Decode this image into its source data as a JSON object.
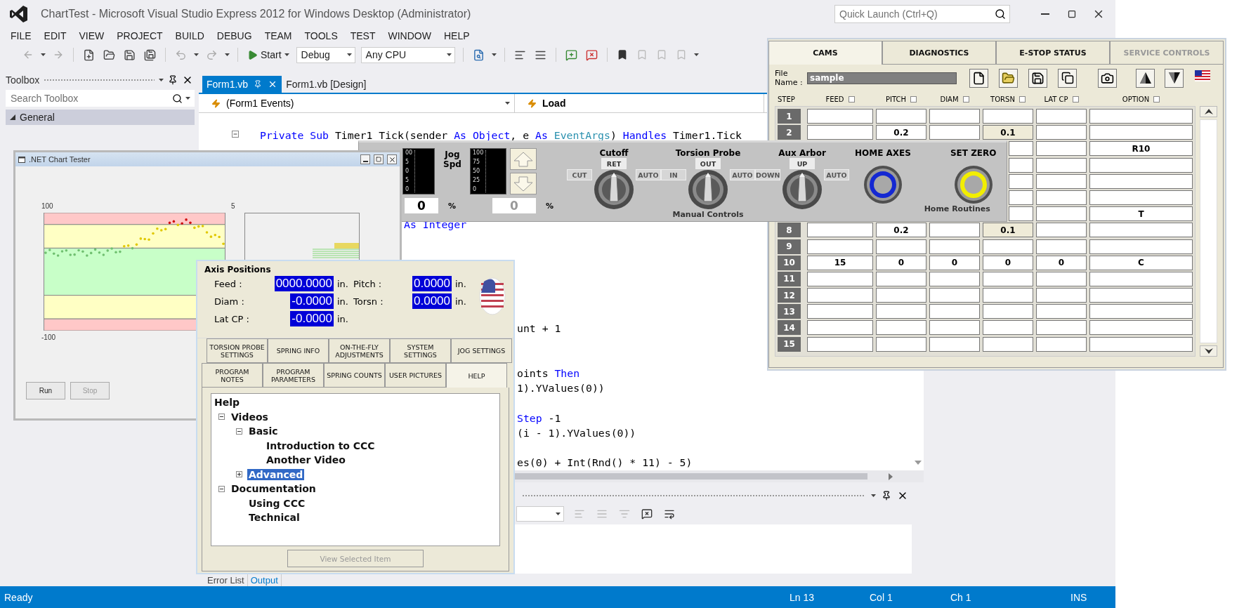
{
  "window": {
    "title": "ChartTest - Microsoft Visual Studio Express 2012 for Windows Desktop (Administrator)",
    "quick_launch": {
      "placeholder": "Quick Launch (Ctrl+Q)"
    }
  },
  "menu": [
    "FILE",
    "EDIT",
    "VIEW",
    "PROJECT",
    "BUILD",
    "DEBUG",
    "TEAM",
    "TOOLS",
    "TEST",
    "WINDOW",
    "HELP"
  ],
  "toolbar": {
    "start": "Start",
    "configuration": "Debug",
    "platform": "Any CPU"
  },
  "toolbox": {
    "title": "Toolbox",
    "search": {
      "placeholder": "Search Toolbox"
    },
    "groups": [
      {
        "label": "General",
        "expanded": true
      }
    ]
  },
  "editor": {
    "tabs": [
      {
        "label": "Form1.vb",
        "selected": true
      },
      {
        "label": "Form1.vb [Design]",
        "selected": false
      }
    ],
    "object_list": "(Form1 Events)",
    "method_list": "Load",
    "code_lines": [
      {
        "parts": [
          {
            "text": "Private Sub",
            "kind": "keyword"
          },
          {
            "text": " Timer1 Tick(sender ",
            "kind": "plain"
          },
          {
            "text": "As Object",
            "kind": "keyword"
          },
          {
            "text": ", e ",
            "kind": "plain"
          },
          {
            "text": "As",
            "kind": "keyword"
          },
          {
            "text": " EventArgs",
            "kind": "type"
          },
          {
            "text": ") ",
            "kind": "plain"
          },
          {
            "text": "Handles",
            "kind": "keyword"
          },
          {
            "text": " Timer1.Tick",
            "kind": "plain"
          }
        ]
      },
      {
        "parts": [
          {
            "text": "As Integer",
            "kind": "keyword"
          }
        ]
      },
      {
        "parts": [
          {
            "text": "unt + 1",
            "kind": "plain"
          }
        ]
      },
      {
        "parts": [
          {
            "text": "oints ",
            "kind": "plain"
          },
          {
            "text": "Then",
            "kind": "keyword"
          }
        ]
      },
      {
        "parts": [
          {
            "text": "1).YValues(0))",
            "kind": "plain"
          }
        ]
      },
      {
        "parts": [
          {
            "text": "Step",
            "kind": "keyword"
          },
          {
            "text": " -1",
            "kind": "plain"
          }
        ]
      },
      {
        "parts": [
          {
            "text": "(i - 1).YValues(0))",
            "kind": "plain"
          }
        ]
      },
      {
        "parts": [
          {
            "text": "es(0) + Int(Rnd() * 11) - 5)",
            "kind": "plain"
          }
        ]
      }
    ]
  },
  "output": {
    "tabs": [
      {
        "label": "Error List",
        "selected": false
      },
      {
        "label": "Output",
        "selected": true
      }
    ]
  },
  "status_bar": {
    "status": "Ready",
    "line": "Ln 13",
    "column": "Col 1",
    "char": "Ch 1",
    "mode": "INS"
  },
  "chart_tester": {
    "title": ".NET Chart Tester",
    "chart_top_label": "100",
    "chart_bottom_label": "-100",
    "second_chart_label": "5",
    "buttons": [
      {
        "label": "Run",
        "disabled": false
      },
      {
        "label": "Stop",
        "disabled": true
      }
    ]
  },
  "machine_panel": {
    "gauges": [
      {
        "ticks": [
          "00",
          "5",
          "0",
          "5",
          "0"
        ],
        "value": "0",
        "unit": "%",
        "disabled": false
      },
      {
        "label": "Jog Spd",
        "ticks": [
          "100",
          "75",
          "50",
          "25",
          "0"
        ],
        "value": "0",
        "unit": "%",
        "disabled": true
      }
    ],
    "selectors": [
      {
        "title": "Cutoff",
        "positions": [
          {
            "label": "RET",
            "selected": true
          },
          {
            "label": "CUT",
            "selected": false
          },
          {
            "label": "AUTO",
            "selected": false
          }
        ]
      },
      {
        "title": "Torsion Probe",
        "positions": [
          {
            "label": "OUT",
            "selected": true
          },
          {
            "label": "IN",
            "selected": false
          },
          {
            "label": "AUTO",
            "selected": false
          }
        ]
      },
      {
        "title": "Aux Arbor",
        "positions": [
          {
            "label": "UP",
            "selected": true
          },
          {
            "label": "DOWN",
            "selected": false
          },
          {
            "label": "AUTO",
            "selected": false
          }
        ]
      }
    ],
    "manual_label": "Manual Controls",
    "home_buttons": [
      {
        "label": "HOME AXES",
        "color": "#1428d2"
      },
      {
        "label": "SET ZERO",
        "color": "#f2ee00"
      }
    ],
    "home_label": "Home Routines"
  },
  "cams_window": {
    "tabs": [
      {
        "label": "CAMS",
        "selected": true,
        "disabled": false
      },
      {
        "label": "DIAGNOSTICS",
        "selected": false,
        "disabled": false
      },
      {
        "label": "E-STOP STATUS",
        "selected": false,
        "disabled": false
      },
      {
        "label": "SERVICE CONTROLS",
        "selected": false,
        "disabled": true
      }
    ],
    "file_name_label": "File Name :",
    "file_name": "sample",
    "step_header": "STEP",
    "columns": [
      {
        "label": "FEED",
        "checked": false
      },
      {
        "label": "PITCH",
        "checked": false
      },
      {
        "label": "DIAM",
        "checked": false
      },
      {
        "label": "TORSN",
        "checked": false
      },
      {
        "label": "LAT CP",
        "checked": false
      },
      {
        "label": "OPTION",
        "checked": false
      }
    ],
    "rows": [
      {
        "step": "1",
        "torsn_marked": false
      },
      {
        "step": "2",
        "pitch": "0.2",
        "torsn": "0.1",
        "torsn_marked": true
      },
      {
        "option": "R10",
        "torsn_marked": false
      },
      {
        "torsn_marked": false
      },
      {
        "torsn_marked": false
      },
      {
        "torsn_marked": false
      },
      {
        "option": "T",
        "torsn_marked": false
      },
      {
        "step": "8",
        "pitch": "0.2",
        "torsn": "0.1",
        "torsn_marked": true
      },
      {
        "step": "9",
        "torsn_marked": false
      },
      {
        "step": "10",
        "feed": "15",
        "pitch": "0",
        "diam": "0",
        "torsn": "0",
        "lat_cp": "0",
        "option": "C",
        "torsn_marked": false
      },
      {
        "step": "11",
        "torsn_marked": false
      },
      {
        "step": "12",
        "torsn_marked": false
      },
      {
        "step": "13",
        "torsn_marked": false
      },
      {
        "step": "14",
        "torsn_marked": false
      },
      {
        "step": "15",
        "torsn_marked": false
      }
    ]
  },
  "axis_window": {
    "title": "Axis Positions",
    "positions": [
      {
        "label": "Feed :",
        "value": "0000.0000",
        "unit": "in."
      },
      {
        "label": "Pitch :",
        "value": "0.0000",
        "unit": "in."
      },
      {
        "label": "Diam :",
        "value": "-0.0000",
        "unit": "in."
      },
      {
        "label": "Torsn :",
        "value": "0.0000",
        "unit": "in."
      },
      {
        "label": "Lat CP :",
        "value": "-0.0000",
        "unit": "in."
      }
    ],
    "tab_rows": [
      {
        "tabs": [
          {
            "label": "TORSION PROBE SETTINGS",
            "selected": false
          },
          {
            "label": "SPRING INFO",
            "selected": false
          },
          {
            "label": "ON-THE-FLY ADJUSTMENTS",
            "selected": false
          },
          {
            "label": "SYSTEM SETTINGS",
            "selected": false
          },
          {
            "label": "JOG SETTINGS",
            "selected": false
          }
        ]
      },
      {
        "tabs": [
          {
            "label": "PROGRAM NOTES",
            "selected": false
          },
          {
            "label": "PROGRAM PARAMETERS",
            "selected": false
          },
          {
            "label": "SPRING COUNTS",
            "selected": false
          },
          {
            "label": "USER PICTURES",
            "selected": false
          },
          {
            "label": "HELP",
            "selected": true
          }
        ]
      }
    ],
    "tree": {
      "root": "Help",
      "children": [
        {
          "label": "Videos",
          "expanded": true,
          "selected": false,
          "children": [
            {
              "label": "Basic",
              "expanded": true,
              "selected": false,
              "children": [
                {
                  "label": "Introduction to CCC",
                  "selected": false
                },
                {
                  "label": "Another Video",
                  "selected": false
                }
              ]
            },
            {
              "label": "Advanced",
              "expanded": false,
              "selected": true
            }
          ]
        },
        {
          "label": "Documentation",
          "expanded": true,
          "selected": false,
          "children": [
            {
              "label": "Using CCC",
              "selected": false
            },
            {
              "label": "Technical",
              "selected": false
            }
          ]
        }
      ]
    },
    "button": {
      "label": "View Selected Item",
      "disabled": true
    }
  }
}
